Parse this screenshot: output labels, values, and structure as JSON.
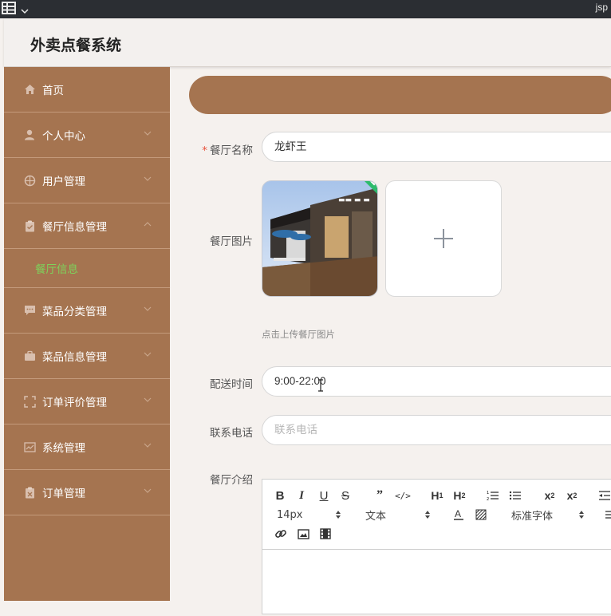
{
  "os_bar": {
    "right_text": "jsp"
  },
  "app": {
    "title": "外卖点餐系统"
  },
  "sidebar": {
    "items": [
      {
        "label": "首页",
        "icon": "home-icon"
      },
      {
        "label": "个人中心",
        "icon": "user-icon"
      },
      {
        "label": "用户管理",
        "icon": "compass-icon"
      },
      {
        "label": "餐厅信息管理",
        "icon": "clipboard-icon"
      },
      {
        "label": "菜品分类管理",
        "icon": "chat-icon"
      },
      {
        "label": "菜品信息管理",
        "icon": "briefcase-icon"
      },
      {
        "label": "订单评价管理",
        "icon": "frame-icon"
      },
      {
        "label": "系统管理",
        "icon": "chart-icon"
      },
      {
        "label": "订单管理",
        "icon": "clipboard-x-icon"
      }
    ],
    "submenu": {
      "label": "餐厅信息"
    }
  },
  "form": {
    "name": {
      "label": "餐厅名称",
      "value": "龙虾王"
    },
    "image": {
      "label": "餐厅图片",
      "hint": "点击上传餐厅图片"
    },
    "delivery": {
      "label": "配送时间",
      "value": "9:00-22:00"
    },
    "phone": {
      "label": "联系电话",
      "placeholder": "联系电话"
    },
    "intro": {
      "label": "餐厅介绍"
    }
  },
  "editor": {
    "font_size": "14px",
    "paragraph": "文本",
    "font_family": "标准字体"
  },
  "colors": {
    "sidebar": "#a57450",
    "active_submenu": "#7dd35b",
    "success_badge": "#2dbb6c"
  }
}
